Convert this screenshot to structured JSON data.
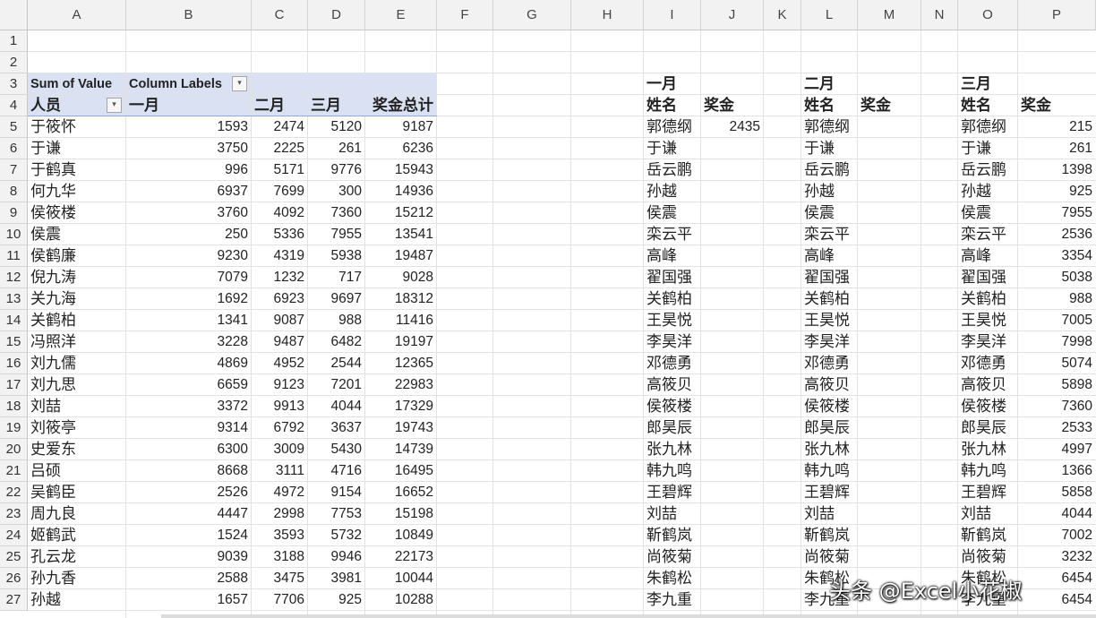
{
  "columns": [
    "A",
    "B",
    "C",
    "D",
    "E",
    "F",
    "G",
    "H",
    "I",
    "J",
    "K",
    "L",
    "M",
    "N",
    "O",
    "P"
  ],
  "rows": [
    "1",
    "2",
    "3",
    "4",
    "5",
    "6",
    "7",
    "8",
    "9",
    "10",
    "11",
    "12",
    "13",
    "14",
    "15",
    "16",
    "17",
    "18",
    "19",
    "20",
    "21",
    "22",
    "23",
    "24",
    "25",
    "26",
    "27"
  ],
  "pivot": {
    "sum_label": "Sum of Value",
    "col_labels": "Column Labels",
    "row_label": "人员",
    "months": [
      "一月",
      "二月",
      "三月"
    ],
    "total_label": "奖金总计",
    "rows": [
      {
        "name": "于筱怀",
        "v": [
          "1593",
          "2474",
          "5120",
          "9187"
        ]
      },
      {
        "name": "于谦",
        "v": [
          "3750",
          "2225",
          "261",
          "6236"
        ]
      },
      {
        "name": "于鹤真",
        "v": [
          "996",
          "5171",
          "9776",
          "15943"
        ]
      },
      {
        "name": "何九华",
        "v": [
          "6937",
          "7699",
          "300",
          "14936"
        ]
      },
      {
        "name": "侯筱楼",
        "v": [
          "3760",
          "4092",
          "7360",
          "15212"
        ]
      },
      {
        "name": "侯震",
        "v": [
          "250",
          "5336",
          "7955",
          "13541"
        ]
      },
      {
        "name": "侯鹤廉",
        "v": [
          "9230",
          "4319",
          "5938",
          "19487"
        ]
      },
      {
        "name": "倪九涛",
        "v": [
          "7079",
          "1232",
          "717",
          "9028"
        ]
      },
      {
        "name": "关九海",
        "v": [
          "1692",
          "6923",
          "9697",
          "18312"
        ]
      },
      {
        "name": "关鹤柏",
        "v": [
          "1341",
          "9087",
          "988",
          "11416"
        ]
      },
      {
        "name": "冯照洋",
        "v": [
          "3228",
          "9487",
          "6482",
          "19197"
        ]
      },
      {
        "name": "刘九儒",
        "v": [
          "4869",
          "4952",
          "2544",
          "12365"
        ]
      },
      {
        "name": "刘九思",
        "v": [
          "6659",
          "9123",
          "7201",
          "22983"
        ]
      },
      {
        "name": "刘喆",
        "v": [
          "3372",
          "9913",
          "4044",
          "17329"
        ]
      },
      {
        "name": "刘筱亭",
        "v": [
          "9314",
          "6792",
          "3637",
          "19743"
        ]
      },
      {
        "name": "史爱东",
        "v": [
          "6300",
          "3009",
          "5430",
          "14739"
        ]
      },
      {
        "name": "吕硕",
        "v": [
          "8668",
          "3111",
          "4716",
          "16495"
        ]
      },
      {
        "name": "吴鹤臣",
        "v": [
          "2526",
          "4972",
          "9154",
          "16652"
        ]
      },
      {
        "name": "周九良",
        "v": [
          "4447",
          "2998",
          "7753",
          "15198"
        ]
      },
      {
        "name": "姬鹤武",
        "v": [
          "1524",
          "3593",
          "5732",
          "10849"
        ]
      },
      {
        "name": "孔云龙",
        "v": [
          "9039",
          "3188",
          "9946",
          "22173"
        ]
      },
      {
        "name": "孙九香",
        "v": [
          "2588",
          "3475",
          "3981",
          "10044"
        ]
      },
      {
        "name": "孙越",
        "v": [
          "1657",
          "7706",
          "925",
          "10288"
        ]
      }
    ]
  },
  "tables": [
    {
      "month": "一月",
      "name_hdr": "姓名",
      "bonus_hdr": "奖金",
      "names": [
        "郭德纲",
        "于谦",
        "岳云鹏",
        "孙越",
        "侯震",
        "栾云平",
        "高峰",
        "翟国强",
        "关鹤柏",
        "王昊悦",
        "李昊洋",
        "邓德勇",
        "高筱贝",
        "侯筱楼",
        "郎昊辰",
        "张九林",
        "韩九鸣",
        "王碧辉",
        "刘喆",
        "靳鹤岚",
        "尚筱菊",
        "朱鹤松",
        "李九重"
      ],
      "bonus": [
        "2435",
        "",
        "",
        "",
        "",
        "",
        "",
        "",
        "",
        "",
        "",
        "",
        "",
        "",
        "",
        "",
        "",
        "",
        "",
        "",
        "",
        "",
        ""
      ]
    },
    {
      "month": "二月",
      "name_hdr": "姓名",
      "bonus_hdr": "奖金",
      "names": [
        "郭德纲",
        "于谦",
        "岳云鹏",
        "孙越",
        "侯震",
        "栾云平",
        "高峰",
        "翟国强",
        "关鹤柏",
        "王昊悦",
        "李昊洋",
        "邓德勇",
        "高筱贝",
        "侯筱楼",
        "郎昊辰",
        "张九林",
        "韩九鸣",
        "王碧辉",
        "刘喆",
        "靳鹤岚",
        "尚筱菊",
        "朱鹤松",
        "李九重"
      ],
      "bonus": [
        "",
        "",
        "",
        "",
        "",
        "",
        "",
        "",
        "",
        "",
        "",
        "",
        "",
        "",
        "",
        "",
        "",
        "",
        "",
        "",
        "",
        "",
        ""
      ]
    },
    {
      "month": "三月",
      "name_hdr": "姓名",
      "bonus_hdr": "奖金",
      "names": [
        "郭德纲",
        "于谦",
        "岳云鹏",
        "孙越",
        "侯震",
        "栾云平",
        "高峰",
        "翟国强",
        "关鹤柏",
        "王昊悦",
        "李昊洋",
        "邓德勇",
        "高筱贝",
        "侯筱楼",
        "郎昊辰",
        "张九林",
        "韩九鸣",
        "王碧辉",
        "刘喆",
        "靳鹤岚",
        "尚筱菊",
        "朱鹤松",
        "李九重"
      ],
      "bonus": [
        "215",
        "261",
        "1398",
        "925",
        "7955",
        "2536",
        "3354",
        "5038",
        "988",
        "7005",
        "7998",
        "5074",
        "5898",
        "7360",
        "2533",
        "4997",
        "1366",
        "5858",
        "4044",
        "7002",
        "3232",
        "6454",
        "6454"
      ]
    }
  ],
  "watermark": "头条 @Excel小花椒"
}
